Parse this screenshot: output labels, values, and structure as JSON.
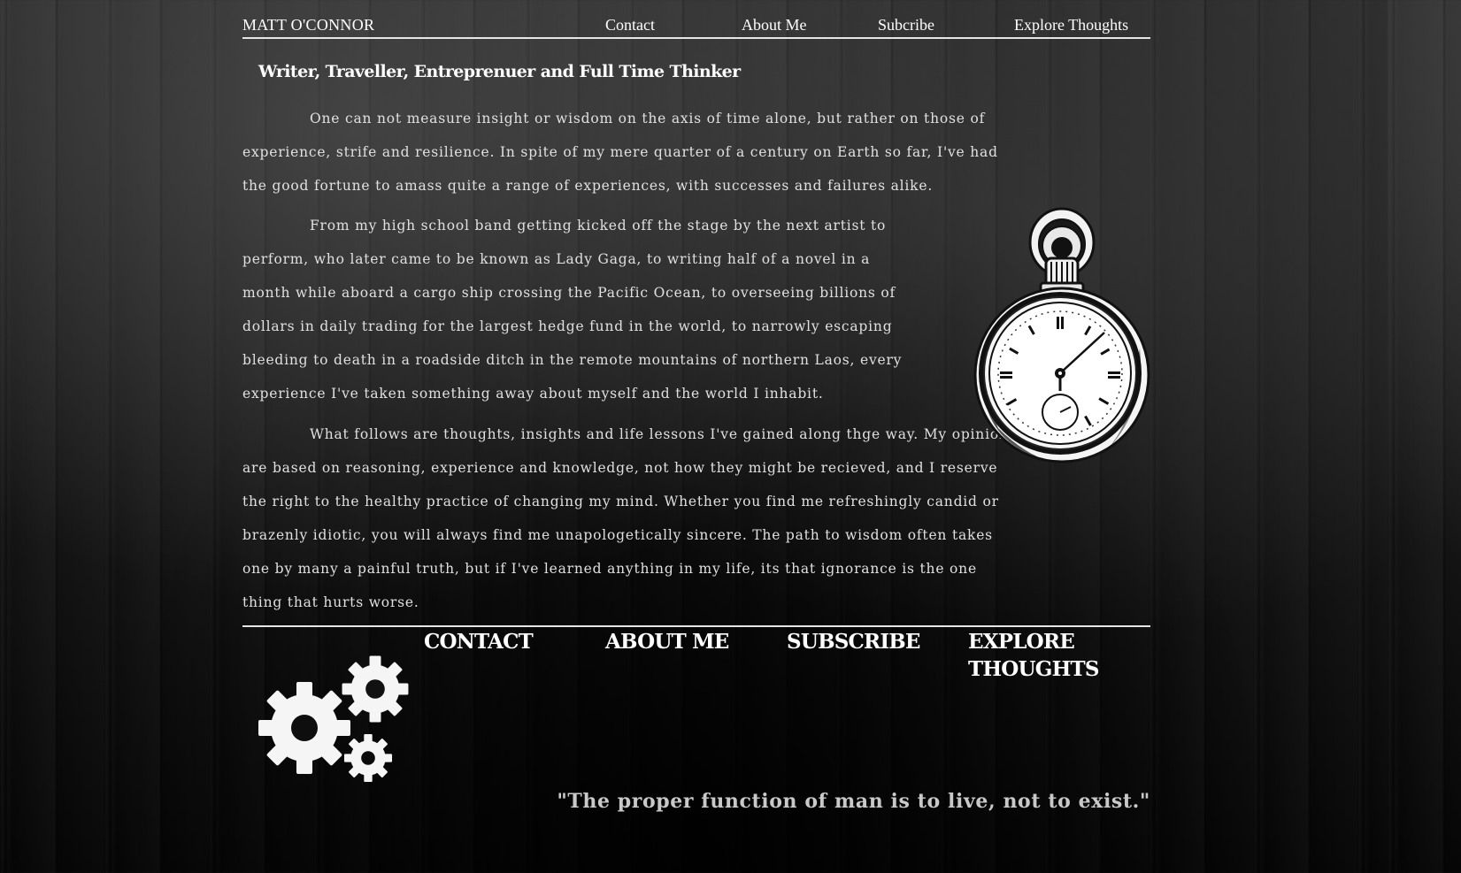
{
  "header": {
    "brand": "MATT O'CONNOR",
    "nav": {
      "contact": "Contact",
      "about": "About Me",
      "subscribe": "Subcribe",
      "explore": "Explore Thoughts"
    }
  },
  "main": {
    "tagline": "Writer, Traveller, Entreprenuer and Full Time Thinker",
    "paragraphs": [
      "One can not measure insight or wisdom on the axis of time alone, but rather on those of experience, strife and resilience. In spite of my mere quarter of a century on Earth so far, I've had the good fortune to amass quite a range of experiences, with successes and failures alike.",
      "From my high school band getting kicked off the stage by the next artist to perform, who later came to be known as Lady Gaga, to writing half of a novel in a month while aboard a cargo ship crossing the Pacific Ocean, to overseeing billions of dollars in daily trading for the largest hedge fund in the world, to narrowly escaping bleeding to death in a roadside ditch in the remote mountains of northern Laos, every experience I've taken something away about myself and the world I inhabit.",
      "What follows are thoughts, insights and life lessons I've gained along thge way. My opinions are based on reasoning, experience and knowledge, not how they might be recieved, and I reserve the right to the healthy practice of changing my mind. Whether you find me refreshingly candid or brazenly idiotic, you will always find me unapologetically sincere. The path to wisdom often takes one by many a painful truth, but if I've learned anything in my life, its that ignorance is the one thing that hurts worse."
    ],
    "image_icon": "pocket-watch-icon"
  },
  "footer": {
    "links": {
      "contact": "CONTACT",
      "about": "ABOUT ME",
      "subscribe": "SUBSCRIBE",
      "explore": "EXPLORE THOUGHTS"
    },
    "icon": "gears-icon",
    "quote": "\"The proper function of man is to live, not to exist.\""
  },
  "colors": {
    "text": "#ffffff",
    "body_text": "#e0e0e0",
    "quote_text": "#c9c9c9",
    "rule": "#e6e6e6",
    "background": "#1a1a1a"
  }
}
